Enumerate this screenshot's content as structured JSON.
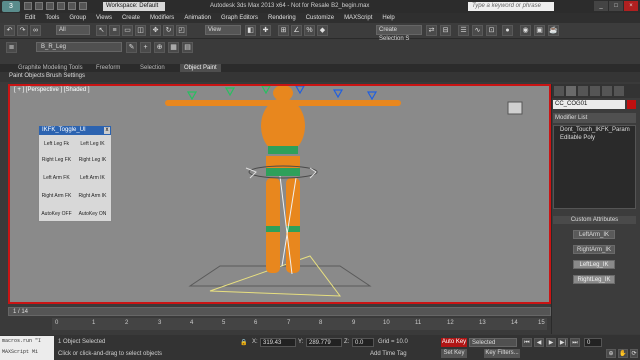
{
  "window": {
    "logo": "3",
    "workspace": "Workspace: Default",
    "title": "Autodesk 3ds Max 2013 x64 - Not for Resale   B2_begin.max",
    "search_placeholder": "Type a keyword or phrase",
    "controls": [
      "_",
      "□",
      "×"
    ]
  },
  "menubar": [
    "Edit",
    "Tools",
    "Group",
    "Views",
    "Create",
    "Modifiers",
    "Animation",
    "Graph Editors",
    "Rendering",
    "Customize",
    "MAXScript",
    "Help"
  ],
  "toolbar": {
    "filter_combo": "All",
    "view_combo": "View",
    "selection_set": "Create Selection S",
    "layer_combo": "B_R_Leg"
  },
  "ribbon": {
    "tabs": [
      "Graphite Modeling Tools",
      "Freeform",
      "Selection",
      "Object Paint"
    ],
    "subtabs": [
      "Paint Objects",
      "Brush Settings"
    ]
  },
  "viewport": {
    "label": "[ + ] [Perspective ] [Shaded ]"
  },
  "ikfk_dialog": {
    "title": "IKFK_Toggle_UI",
    "close": "x",
    "buttons": [
      [
        "Left Leg Fk",
        "Left Leg IK"
      ],
      [
        "Right Leg FK",
        "Right Leg IK"
      ],
      [
        "Left Arm FK",
        "Left Arm IK"
      ],
      [
        "Right Arm FK",
        "Right Arm IK"
      ],
      [
        "AutoKey OFF",
        "AutoKey ON"
      ]
    ]
  },
  "command_panel": {
    "object_name": "CC_COG01",
    "object_color": "#c01010",
    "modifier_list": "Modifier List",
    "stack": [
      "Dont_Touch_IKFK_Param",
      "Editable Poly"
    ],
    "attributes_header": "Custom Attributes",
    "attributes": [
      "LeftArm_IK",
      "RightArm_IK",
      "LeftLeg_IK",
      "RightLeg_IK"
    ]
  },
  "timeline": {
    "slider": "1 / 14",
    "ticks": [
      "0",
      "1",
      "2",
      "3",
      "4",
      "5",
      "6",
      "7",
      "8",
      "9",
      "10",
      "11",
      "12",
      "13",
      "14",
      "15"
    ]
  },
  "status": {
    "objects_selected": "1 Object Selected",
    "prompt": "Click or click-and-drag to select objects",
    "x": "319.43",
    "y": "289.779",
    "z": "0.0",
    "grid": "Grid = 10.0",
    "add_time_tag": "Add Time Tag",
    "autokey": "Auto Key",
    "selected": "Selected",
    "setkey": "Set Key",
    "keyfilters": "Key Filters...",
    "frame": "0"
  },
  "maxscript": {
    "line1": "macros.run \"I",
    "line2": "MAXScript Mi"
  }
}
